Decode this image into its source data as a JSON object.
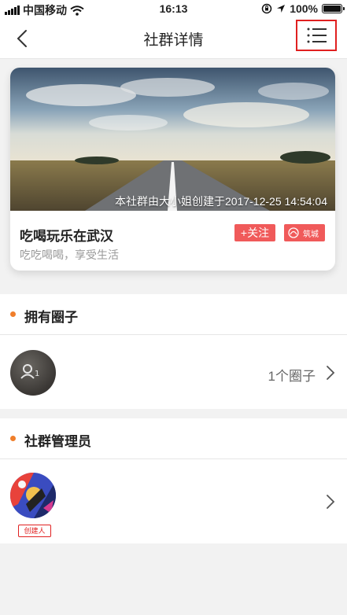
{
  "status_bar": {
    "carrier": "中国移动",
    "time": "16:13",
    "battery": "100%",
    "icons": [
      "signal-icon",
      "wifi-icon",
      "rotation-lock-icon",
      "location-icon",
      "battery-icon"
    ]
  },
  "navbar": {
    "title": "社群详情",
    "back_icon": "back-arrow-icon",
    "menu_icon": "list-menu-icon"
  },
  "group_card": {
    "cover_caption": "本社群由大小姐创建于2017-12-25 14:54:04",
    "name": "吃喝玩乐在武汉",
    "description": "吃吃喝喝，享受生活",
    "follow_label": "+关注",
    "city_label": "筑城"
  },
  "circles_section": {
    "title": "拥有圈子",
    "count_label": "1个圈子"
  },
  "admins_section": {
    "title": "社群管理员",
    "creator_tag": "创建人"
  },
  "colors": {
    "accent_orange": "#f07e2a",
    "follow_red": "#f05a5a",
    "highlight_red": "#e02020"
  }
}
